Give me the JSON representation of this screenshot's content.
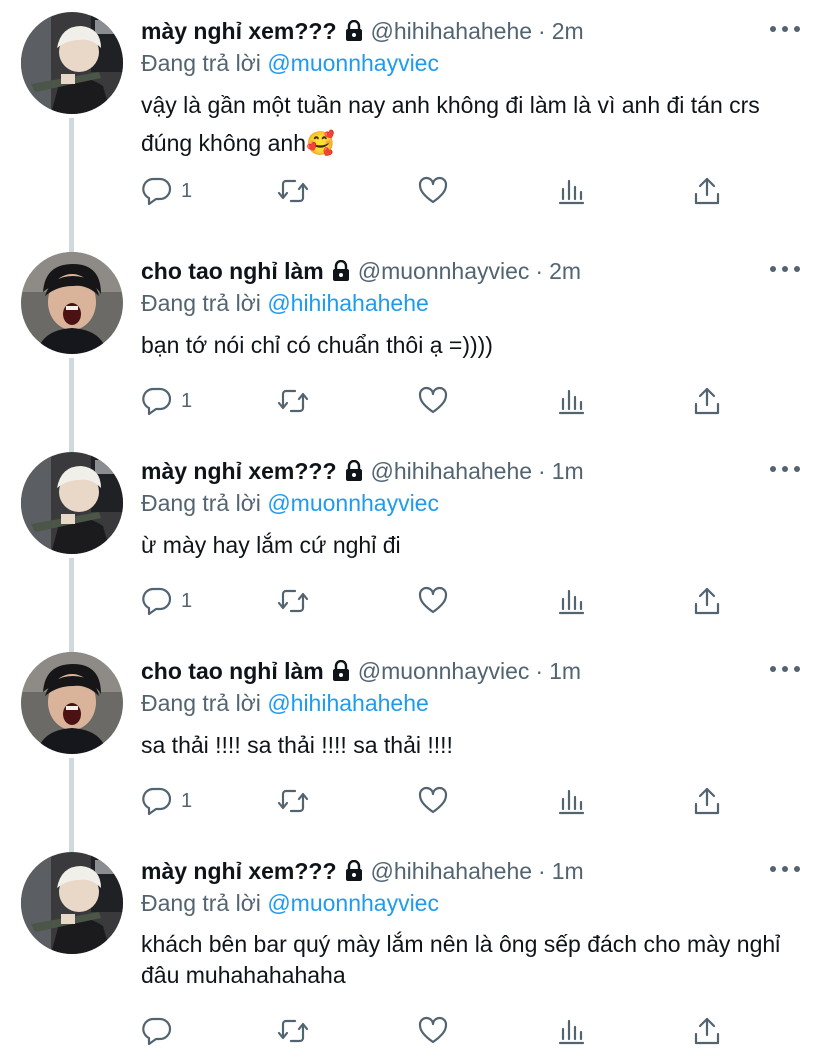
{
  "reply_prefix": "Đang trả lời",
  "tweets": [
    {
      "name": "mày nghỉ xem???",
      "handle": "@hihihahahehe",
      "separator": "·",
      "time": "2m",
      "reply_to": "@muonnhayviec",
      "text": "vậy là gần một tuần nay anh không đi làm là vì anh đi tán crs đúng không anh🥰",
      "reply_count": "1",
      "avatar": "blonde-avatar"
    },
    {
      "name": "cho tao nghỉ làm",
      "handle": "@muonnhayviec",
      "separator": "·",
      "time": "2m",
      "reply_to": "@hihihahahehe",
      "text": "bạn tớ nói chỉ có chuẩn thôi ạ =))))",
      "reply_count": "1",
      "avatar": "screaming-avatar"
    },
    {
      "name": "mày nghỉ xem???",
      "handle": "@hihihahahehe",
      "separator": "·",
      "time": "1m",
      "reply_to": "@muonnhayviec",
      "text": "ừ mày hay lắm cứ nghỉ đi",
      "reply_count": "1",
      "avatar": "blonde-avatar"
    },
    {
      "name": "cho tao nghỉ làm",
      "handle": "@muonnhayviec",
      "separator": "·",
      "time": "1m",
      "reply_to": "@hihihahahehe",
      "text": "sa thải !!!! sa thải !!!! sa thải !!!!",
      "reply_count": "1",
      "avatar": "screaming-avatar"
    },
    {
      "name": "mày nghỉ xem???",
      "handle": "@hihihahahehe",
      "separator": "·",
      "time": "1m",
      "reply_to": "@muonnhayviec",
      "text": "khách bên bar quý mày lắm nên là ông sếp đách cho mày nghỉ đâu muhahahahaha",
      "reply_count": "",
      "avatar": "blonde-avatar"
    }
  ],
  "colors": {
    "text": "#0f1419",
    "secondary": "#536471",
    "link": "#1d9bf0",
    "thread_line": "#cfd9de"
  },
  "icons": [
    "lock-icon",
    "more-icon",
    "reply-icon",
    "retweet-icon",
    "like-icon",
    "views-icon",
    "share-icon"
  ]
}
